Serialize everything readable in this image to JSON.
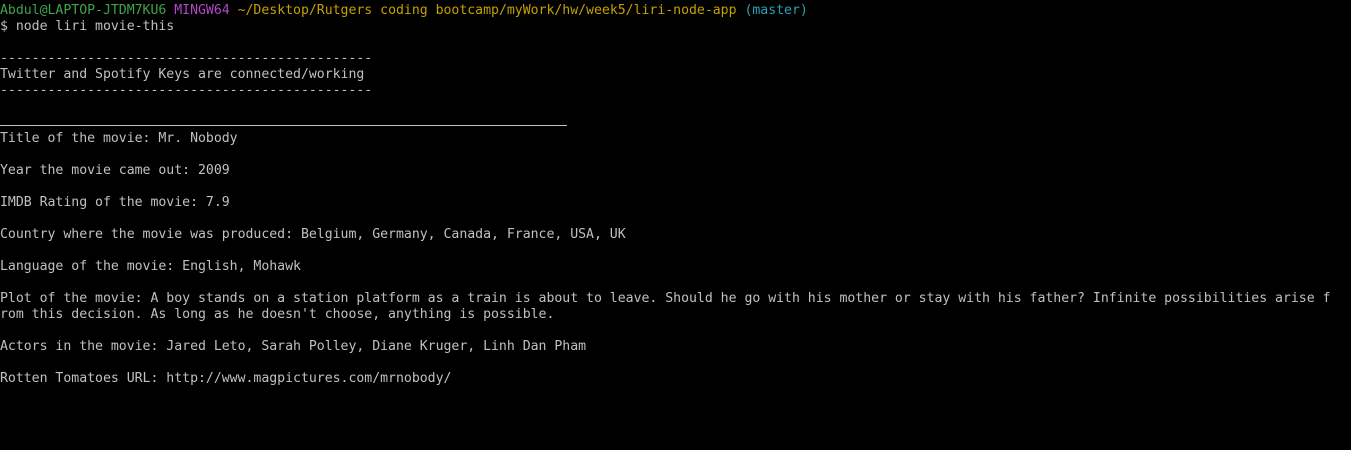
{
  "prompt": {
    "user_host": "Abdul@LAPTOP-JTDM7KU6",
    "env": "MINGW64",
    "path": "~/Desktop/Rutgers coding bootcamp/myWork/hw/week5/liri-node-app",
    "branch": "(master)"
  },
  "command": "$ node liri movie-this",
  "output": {
    "dash_line": "-----------------------------------------------",
    "keys_message": "Twitter and Spotify Keys are connected/working",
    "title": "Title of the movie: Mr. Nobody",
    "year": "Year the movie came out: 2009",
    "imdb": "IMDB Rating of the movie: 7.9",
    "country": "Country where the movie was produced: Belgium, Germany, Canada, France, USA, UK",
    "language": "Language of the movie: English, Mohawk",
    "plot_line1": "Plot of the movie: A boy stands on a station platform as a train is about to leave. Should he go with his mother or stay with his father? Infinite possibilities arise f",
    "plot_line2": "rom this decision. As long as he doesn't choose, anything is possible.",
    "actors": "Actors in the movie: Jared Leto, Sarah Polley, Diane Kruger, Linh Dan Pham",
    "rotten": "Rotten Tomatoes URL: http://www.magpictures.com/mrnobody/"
  }
}
